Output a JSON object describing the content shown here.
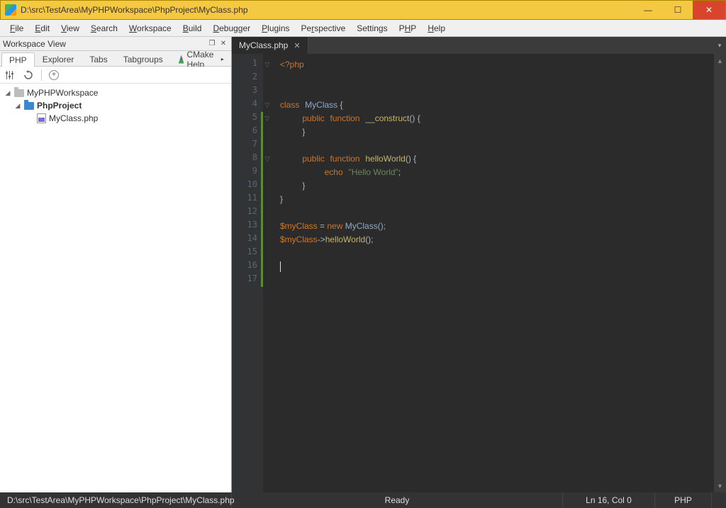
{
  "title": "D:\\src\\TestArea\\MyPHPWorkspace\\PhpProject\\MyClass.php",
  "menu": [
    "File",
    "Edit",
    "View",
    "Search",
    "Workspace",
    "Build",
    "Debugger",
    "Plugins",
    "Perspective",
    "Settings",
    "PHP",
    "Help"
  ],
  "panel_title": "Workspace View",
  "panel_tabs": {
    "active": "PHP",
    "items": [
      "PHP",
      "Explorer",
      "Tabs",
      "Tabgroups"
    ],
    "cmake": "CMake Help"
  },
  "tree": {
    "root": "MyPHPWorkspace",
    "project": "PhpProject",
    "file": "MyClass.php"
  },
  "editor_tab": "MyClass.php",
  "code": {
    "l1_open": "<?php",
    "l4_class": "class",
    "l4_name": "MyClass",
    "l4_brace": " {",
    "l5_pub": "public",
    "l5_func": "function",
    "l5_name": "__construct",
    "l5_par": "() {",
    "l6_close": "}",
    "l8_pub": "public",
    "l8_func": "function",
    "l8_name": "helloWorld",
    "l8_par": "() {",
    "l9_echo": "echo",
    "l9_str": "\"Hello World\"",
    "l9_semi": ";",
    "l10_close": "}",
    "l11_close": "}",
    "l13_var": "$myClass",
    "l13_eq": " = ",
    "l13_new": "new",
    "l13_cls": " MyClass();",
    "l14_var": "$myClass",
    "l14_arrow": "->",
    "l14_call": "helloWorld",
    "l14_end": "();"
  },
  "status": {
    "path": "D:\\src\\TestArea\\MyPHPWorkspace\\PhpProject\\MyClass.php",
    "state": "Ready",
    "pos": "Ln 16, Col 0",
    "lang": "PHP"
  }
}
